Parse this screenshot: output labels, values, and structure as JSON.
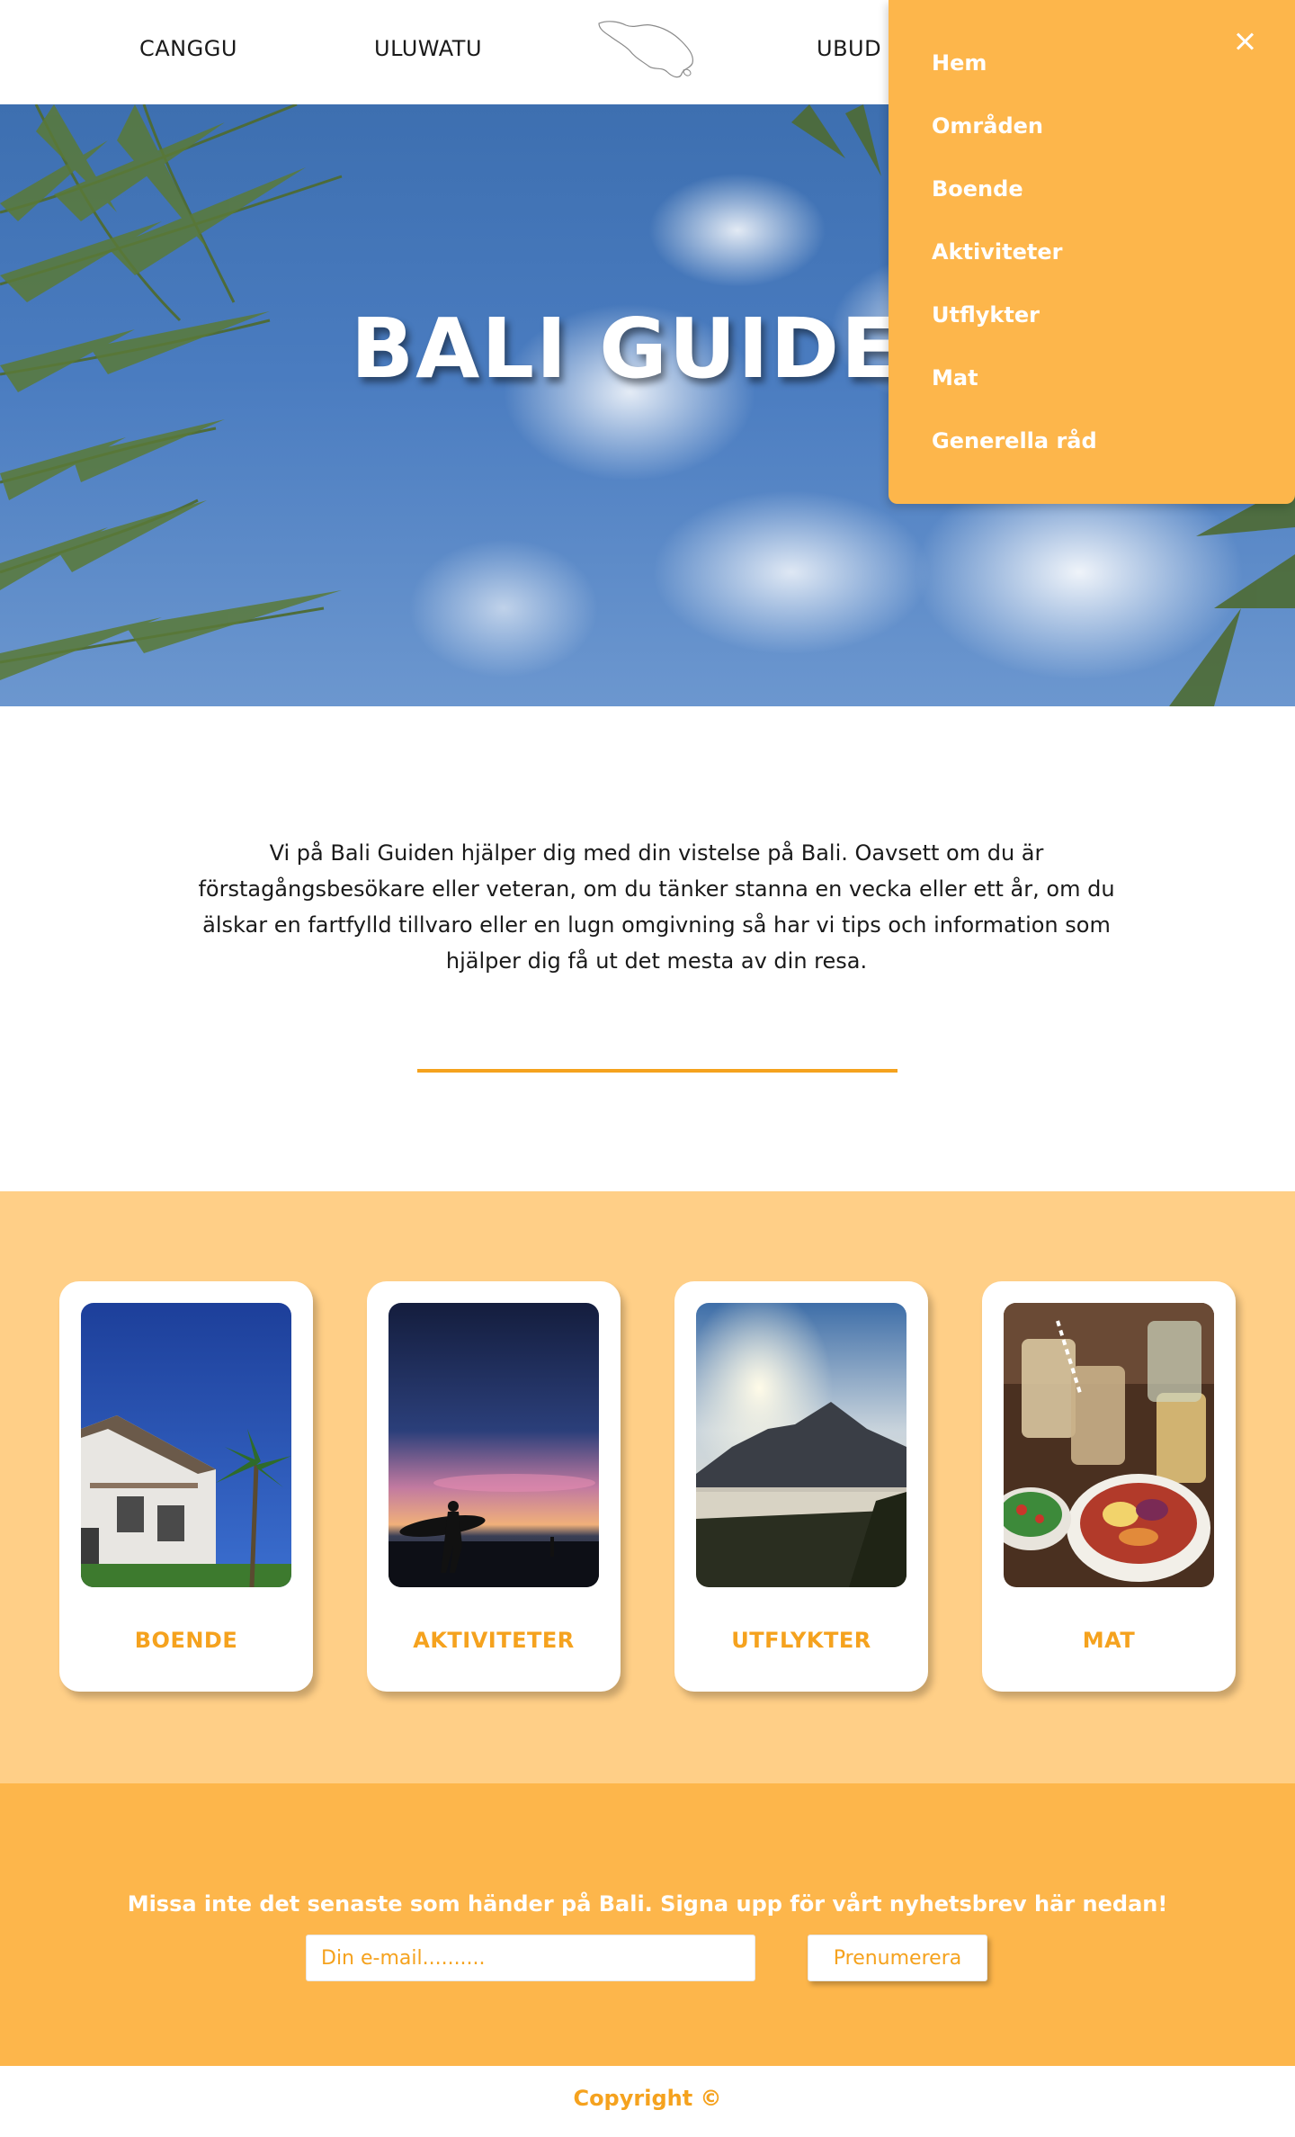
{
  "header": {
    "nav_left": [
      "CANGGU",
      "ULUWATU"
    ],
    "nav_right": [
      "UBUD"
    ],
    "logo_icon": "bali-island-outline-icon"
  },
  "hero": {
    "title": "BALI GUIDEN"
  },
  "menu": {
    "close_icon": "close-icon",
    "items": [
      "Hem",
      "Områden",
      "Boende",
      "Aktiviteter",
      "Utflykter",
      "Mat",
      "Generella råd"
    ]
  },
  "intro": {
    "text": "Vi på Bali Guiden hjälper dig med din vistelse på Bali. Oavsett om du är förstagångsbesökare eller veteran, om du tänker stanna en vecka eller ett år, om du älskar en fartfylld tillvaro eller en lugn omgivning så har vi tips och information som hjälper dig få ut det mesta av din resa."
  },
  "cards": [
    {
      "label": "BOENDE"
    },
    {
      "label": "AKTIVITETER"
    },
    {
      "label": "UTFLYKTER"
    },
    {
      "label": "MAT"
    }
  ],
  "newsletter": {
    "text": "Missa inte det senaste som händer på Bali. Signa upp för vårt nyhetsbrev här nedan!",
    "email_placeholder": "Din e-mail..........",
    "subscribe_label": "Prenumerera"
  },
  "footer": {
    "copyright": "Copyright ©"
  },
  "colors": {
    "accent": "#f5a21e",
    "menu_bg": "#fdb64b",
    "cards_bg": "#ffcf87"
  }
}
